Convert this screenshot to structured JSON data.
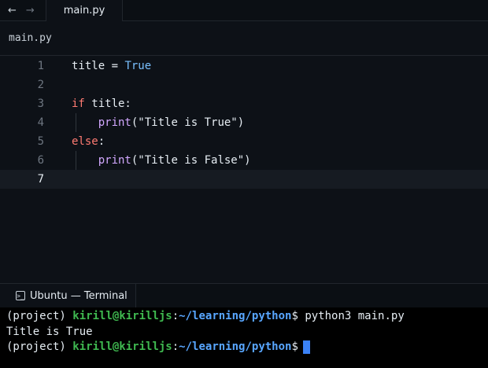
{
  "tabbar": {
    "back_icon": "arrow-left-icon",
    "forward_icon": "arrow-right-icon",
    "back_glyph": "←",
    "forward_glyph": "→",
    "active_tab": "main.py"
  },
  "breadcrumb": {
    "file": "main.py"
  },
  "editor": {
    "active_line": 7,
    "lines": [
      {
        "num": "1",
        "tokens": [
          {
            "t": "title = ",
            "c": ""
          },
          {
            "t": "True",
            "c": "bool"
          }
        ]
      },
      {
        "num": "2",
        "tokens": []
      },
      {
        "num": "3",
        "tokens": [
          {
            "t": "if",
            "c": "kw"
          },
          {
            "t": " title:",
            "c": ""
          }
        ]
      },
      {
        "num": "4",
        "tokens": [
          {
            "t": "    ",
            "c": ""
          },
          {
            "t": "print",
            "c": "fn"
          },
          {
            "t": "(\"Title is True\")",
            "c": "str"
          }
        ]
      },
      {
        "num": "5",
        "tokens": [
          {
            "t": "else",
            "c": "kw"
          },
          {
            "t": ":",
            "c": ""
          }
        ]
      },
      {
        "num": "6",
        "tokens": [
          {
            "t": "    ",
            "c": ""
          },
          {
            "t": "print",
            "c": "fn"
          },
          {
            "t": "(\"Title is False\")",
            "c": "str"
          }
        ]
      },
      {
        "num": "7",
        "tokens": []
      }
    ]
  },
  "terminal": {
    "tab_label": "Ubuntu — Terminal",
    "tab_icon": "terminal-icon",
    "tab_icon_glyph": ">_",
    "lines": [
      {
        "prefix": "(project) ",
        "user": "kirill@kirilljs",
        "sep": ":",
        "path": "~/learning/python",
        "suffix": "$ python3 main.py"
      },
      {
        "output": "Title is True"
      },
      {
        "prefix": "(project) ",
        "user": "kirill@kirilljs",
        "sep": ":",
        "path": "~/learning/python",
        "suffix": "$",
        "cursor": true
      }
    ]
  },
  "colors": {
    "background": "#0d1117",
    "keyword": "#ff7b72",
    "boolean": "#79c0ff",
    "function": "#d2a8ff",
    "prompt_user": "#3fb950",
    "prompt_path": "#58a6ff",
    "cursor": "#3b82f6"
  }
}
